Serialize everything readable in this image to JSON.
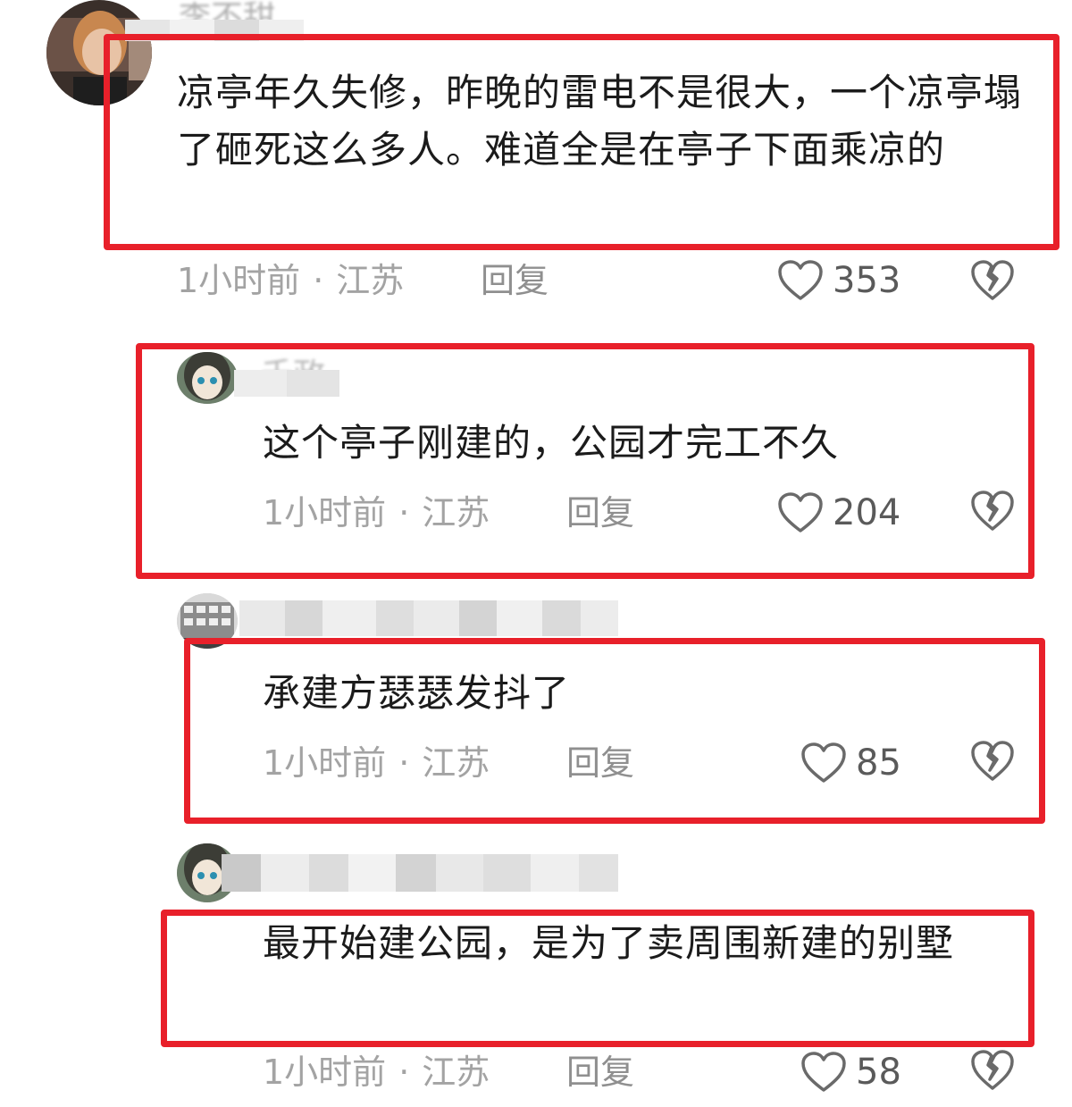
{
  "colors": {
    "highlight_box": "#e8202a",
    "meta_text": "#a3a3a3",
    "body_text": "#1b1b1b"
  },
  "comments": [
    {
      "username": "李不甜",
      "avatar": "user-avatar-photo",
      "text": "凉亭年久失修，昨晚的雷电不是很大，一个凉亭塌了砸死这么多人。难道全是在亭子下面乘凉的",
      "time": "1小时前",
      "location": "江苏",
      "separator": "·",
      "reply_label": "回复",
      "likes": "353",
      "like_icon": "heart-outline-icon",
      "dislike_icon": "broken-heart-icon"
    },
    {
      "username": "千政",
      "avatar": "anime-girl-avatar",
      "text": "这个亭子刚建的，公园才完工不久",
      "time": "1小时前",
      "location": "江苏",
      "separator": "·",
      "reply_label": "回复",
      "likes": "204",
      "like_icon": "heart-outline-icon",
      "dislike_icon": "broken-heart-icon"
    },
    {
      "username": "",
      "avatar": "building-avatar",
      "text": "承建方瑟瑟发抖了",
      "time": "1小时前",
      "location": "江苏",
      "separator": "·",
      "reply_label": "回复",
      "likes": "85",
      "like_icon": "heart-outline-icon",
      "dislike_icon": "broken-heart-icon"
    },
    {
      "username": "",
      "avatar": "anime-girl-avatar",
      "text": "最开始建公园，是为了卖周围新建的别墅",
      "time": "1小时前",
      "location": "江苏",
      "separator": "·",
      "reply_label": "回复",
      "likes": "58",
      "like_icon": "heart-outline-icon",
      "dislike_icon": "broken-heart-icon"
    }
  ]
}
